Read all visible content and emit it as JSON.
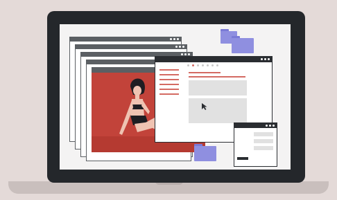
{
  "scene": {
    "kind": "illustration",
    "colors": {
      "background": "#e4dad8",
      "laptop": "#24272b",
      "screen": "#f4f3f3",
      "photo": "#c2433a",
      "accent_line": "#d46a62",
      "folder": "#8f8fe0"
    },
    "icons": [
      "folder-icon",
      "cursor-icon",
      "window-dots-icon"
    ]
  }
}
